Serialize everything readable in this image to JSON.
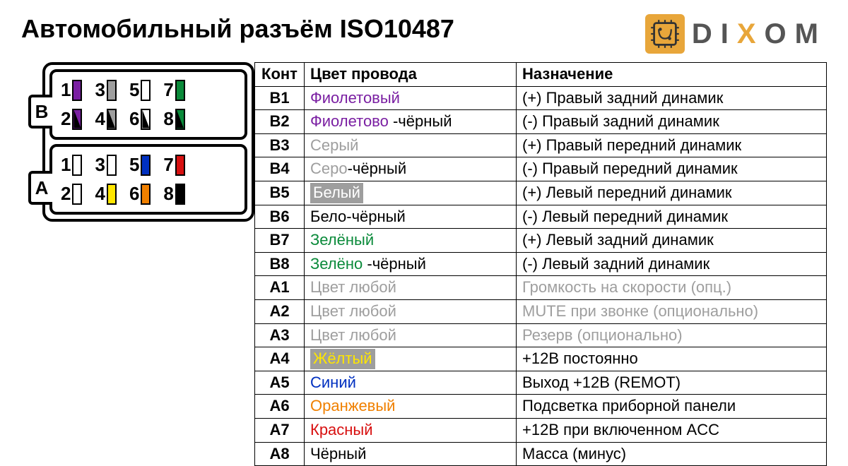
{
  "title": "Автомобильный разъём ISO10487",
  "logo": {
    "d": "D",
    "i": "I",
    "x": "X",
    "o": "O",
    "m": "M"
  },
  "connector": {
    "B": {
      "label": "B",
      "rows": [
        [
          {
            "n": "1",
            "fill": "#7a1fa2",
            "mode": "solid"
          },
          {
            "n": "3",
            "fill": "#9e9e9e",
            "mode": "solid"
          },
          {
            "n": "5",
            "fill": "#ffffff",
            "mode": "solid"
          },
          {
            "n": "7",
            "fill": "#0a8a3a",
            "mode": "solid"
          }
        ],
        [
          {
            "n": "2",
            "fill": "#7a1fa2",
            "mode": "diag"
          },
          {
            "n": "4",
            "fill": "#9e9e9e",
            "mode": "diag"
          },
          {
            "n": "6",
            "fill": "#ffffff",
            "mode": "diag"
          },
          {
            "n": "8",
            "fill": "#0a8a3a",
            "mode": "diag"
          }
        ]
      ]
    },
    "A": {
      "label": "A",
      "rows": [
        [
          {
            "n": "1",
            "fill": "#ffffff",
            "mode": "solid"
          },
          {
            "n": "3",
            "fill": "#ffffff",
            "mode": "solid"
          },
          {
            "n": "5",
            "fill": "#0030c0",
            "mode": "solid"
          },
          {
            "n": "7",
            "fill": "#d81010",
            "mode": "solid"
          }
        ],
        [
          {
            "n": "2",
            "fill": "#ffffff",
            "mode": "solid"
          },
          {
            "n": "4",
            "fill": "#ffe600",
            "mode": "solid"
          },
          {
            "n": "6",
            "fill": "#f08000",
            "mode": "solid"
          },
          {
            "n": "8",
            "fill": "#000000",
            "mode": "solid"
          }
        ]
      ]
    }
  },
  "table": {
    "headers": {
      "pin": "Конт",
      "color": "Цвет провода",
      "func": "Назначение"
    },
    "rows": [
      {
        "pin": "B1",
        "color_parts": [
          {
            "t": "Фиолетовый",
            "c": "#7a1fa2"
          }
        ],
        "func": "(+) Правый задний динамик"
      },
      {
        "pin": "B2",
        "color_parts": [
          {
            "t": "Фиолетово",
            "c": "#7a1fa2"
          },
          {
            "t": " -чёрный",
            "c": "#000"
          }
        ],
        "func": "(-)  Правый задний динамик"
      },
      {
        "pin": "B3",
        "color_parts": [
          {
            "t": "Серый",
            "c": "#9e9e9e"
          }
        ],
        "func": "(+) Правый передний динамик"
      },
      {
        "pin": "B4",
        "color_parts": [
          {
            "t": "Серо",
            "c": "#9e9e9e"
          },
          {
            "t": "-чёрный",
            "c": "#000"
          }
        ],
        "func": "(-)  Правый передний динамик"
      },
      {
        "pin": "B5",
        "color_parts": [
          {
            "t": "Белый",
            "hl": "grey"
          }
        ],
        "func": "(+) Левый передний динамик"
      },
      {
        "pin": "B6",
        "color_parts": [
          {
            "t": "Бело-чёрный",
            "c": "#000"
          }
        ],
        "func": "(-)  Левый передний динамик"
      },
      {
        "pin": "B7",
        "color_parts": [
          {
            "t": "Зелёный",
            "c": "#0a8a3a"
          }
        ],
        "func": "(+) Левый задний динамик"
      },
      {
        "pin": "B8",
        "color_parts": [
          {
            "t": "Зелёно",
            "c": "#0a8a3a"
          },
          {
            "t": " -чёрный",
            "c": "#000"
          }
        ],
        "func": "(-)  Левый задний динамик"
      },
      {
        "pin": "A1",
        "muted": true,
        "color_parts": [
          {
            "t": "Цвет любой"
          }
        ],
        "func": "Громкость на скорости (опц.)"
      },
      {
        "pin": "A2",
        "muted": true,
        "color_parts": [
          {
            "t": "Цвет любой"
          }
        ],
        "func": "MUTE при звонке (опционально)"
      },
      {
        "pin": "A3",
        "muted": true,
        "color_parts": [
          {
            "t": "Цвет любой"
          }
        ],
        "func": "Резерв (опционально)"
      },
      {
        "pin": "A4",
        "color_parts": [
          {
            "t": "Жёлтый",
            "hl": "yellow"
          }
        ],
        "func": "+12В постоянно"
      },
      {
        "pin": "A5",
        "color_parts": [
          {
            "t": "Синий",
            "c": "#0030c0"
          }
        ],
        "func": "Выход +12B (REMOT)"
      },
      {
        "pin": "A6",
        "color_parts": [
          {
            "t": "Оранжевый",
            "c": "#f08000"
          }
        ],
        "func": "Подсветка приборной панели"
      },
      {
        "pin": "A7",
        "color_parts": [
          {
            "t": "Красный",
            "c": "#d81010"
          }
        ],
        "func": "+12B при включенном ACC"
      },
      {
        "pin": "A8",
        "color_parts": [
          {
            "t": "Чёрный",
            "c": "#000"
          }
        ],
        "func": "Масса (минус)"
      }
    ]
  }
}
